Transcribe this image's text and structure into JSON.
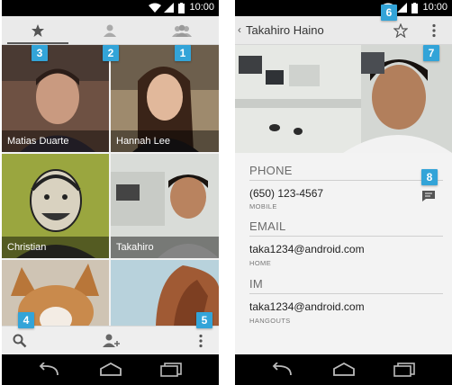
{
  "left_screen": {
    "status_time": "10:00",
    "tabs": [
      {
        "icon": "star-icon",
        "badge": "3"
      },
      {
        "icon": "person-icon",
        "badge": "2"
      },
      {
        "icon": "group-icon",
        "badge": "1"
      }
    ],
    "contacts": [
      {
        "name": "Matias Duarte"
      },
      {
        "name": "Hannah Lee"
      },
      {
        "name": "Christian"
      },
      {
        "name": "Takahiro"
      },
      {
        "name": ""
      },
      {
        "name": ""
      }
    ],
    "bottom_bar": {
      "search_badge": "4",
      "overflow_badge": "5"
    }
  },
  "right_screen": {
    "status_time": "10:00",
    "title": "Takahiro Haino",
    "star_badge": "6",
    "overflow_badge": "7",
    "message_badge": "8",
    "sections": {
      "phone": {
        "header": "PHONE",
        "value": "(650) 123-4567",
        "type": "MOBILE"
      },
      "email": {
        "header": "EMAIL",
        "value": "taka1234@android.com",
        "type": "HOME"
      },
      "im": {
        "header": "IM",
        "value": "taka1234@android.com",
        "type": "HANGOUTS"
      }
    }
  },
  "colors": {
    "badge": "#33a4d8",
    "bar_background": "#eaeaea",
    "system_bar": "#000000"
  }
}
